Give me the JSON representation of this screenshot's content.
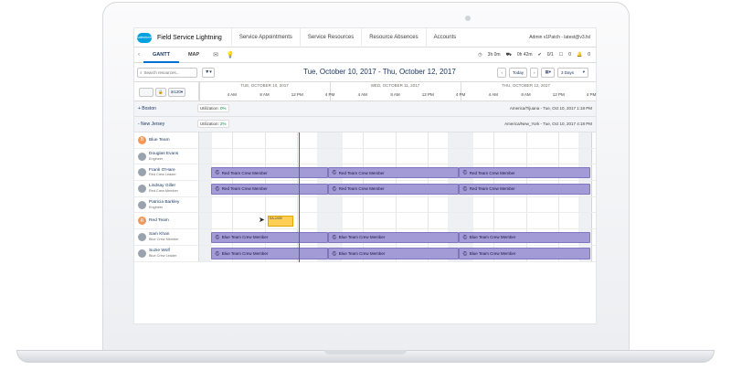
{
  "app": {
    "logo_text": "salesforce",
    "name": "Field Service Lightning",
    "tabs": [
      "Service Appointments",
      "Service Resources",
      "Resource Absences",
      "Accounts"
    ],
    "user": "Admin v1Patch - latest@v3.fsl"
  },
  "subnav": {
    "tabs": [
      "GANTT",
      "MAP"
    ],
    "active_tab": "GANTT",
    "counters": {
      "time1": "3h 0m",
      "time2": "0h 42m",
      "approved": "0/1",
      "rules": "0",
      "alerts": "0"
    }
  },
  "toolbar": {
    "search_placeholder": "Search resources...",
    "date_range": "Tue, October 10, 2017 - Thu, October 12, 2017",
    "today_label": "Today",
    "view_label": "3 Days"
  },
  "gantt": {
    "zoom": "120",
    "days": [
      "TUE, OCTOBER 10, 2017",
      "WED, OCTOBER 11, 2017",
      "THU, OCTOBER 12, 2017"
    ],
    "hours": [
      "4 AM",
      "8 AM",
      "12 PM",
      "4 PM",
      "4 AM",
      "8 AM",
      "12 PM",
      "4 PM",
      "4 AM",
      "8 AM",
      "12 PM",
      "4 PM"
    ],
    "groups": [
      {
        "name": "+ Boston",
        "utilization_label": "Utilization:",
        "utilization": "0%",
        "local_time": "America/Tijuana - Tue, Oct 10, 2017 1:18 PM"
      },
      {
        "name": "- New Jersey",
        "utilization_label": "Utilization:",
        "utilization": "2%",
        "local_time": "America/New_York - Tue, Oct 10, 2017 4:18 PM"
      }
    ],
    "resources": [
      {
        "name": "Blue Team",
        "role": "",
        "team_initial": "B"
      },
      {
        "name": "Douglas Evans",
        "role": "Engineer"
      },
      {
        "name": "Frank O'Hare",
        "role": "Red Crew Leader"
      },
      {
        "name": "Lindsay Giller",
        "role": "Red Crew Member"
      },
      {
        "name": "Patricia Barkley",
        "role": "Engineer"
      },
      {
        "name": "Red Team",
        "role": "",
        "team_initial": "R"
      },
      {
        "name": "Sam Khan",
        "role": "Blue Crew Member"
      },
      {
        "name": "Suzie Wolf",
        "role": "Blue Crew Leader"
      }
    ],
    "red_block_label": "Red Team Crew Member",
    "blue_block_label": "Blue Team Crew Member",
    "appointment_label": "SA-2409"
  }
}
